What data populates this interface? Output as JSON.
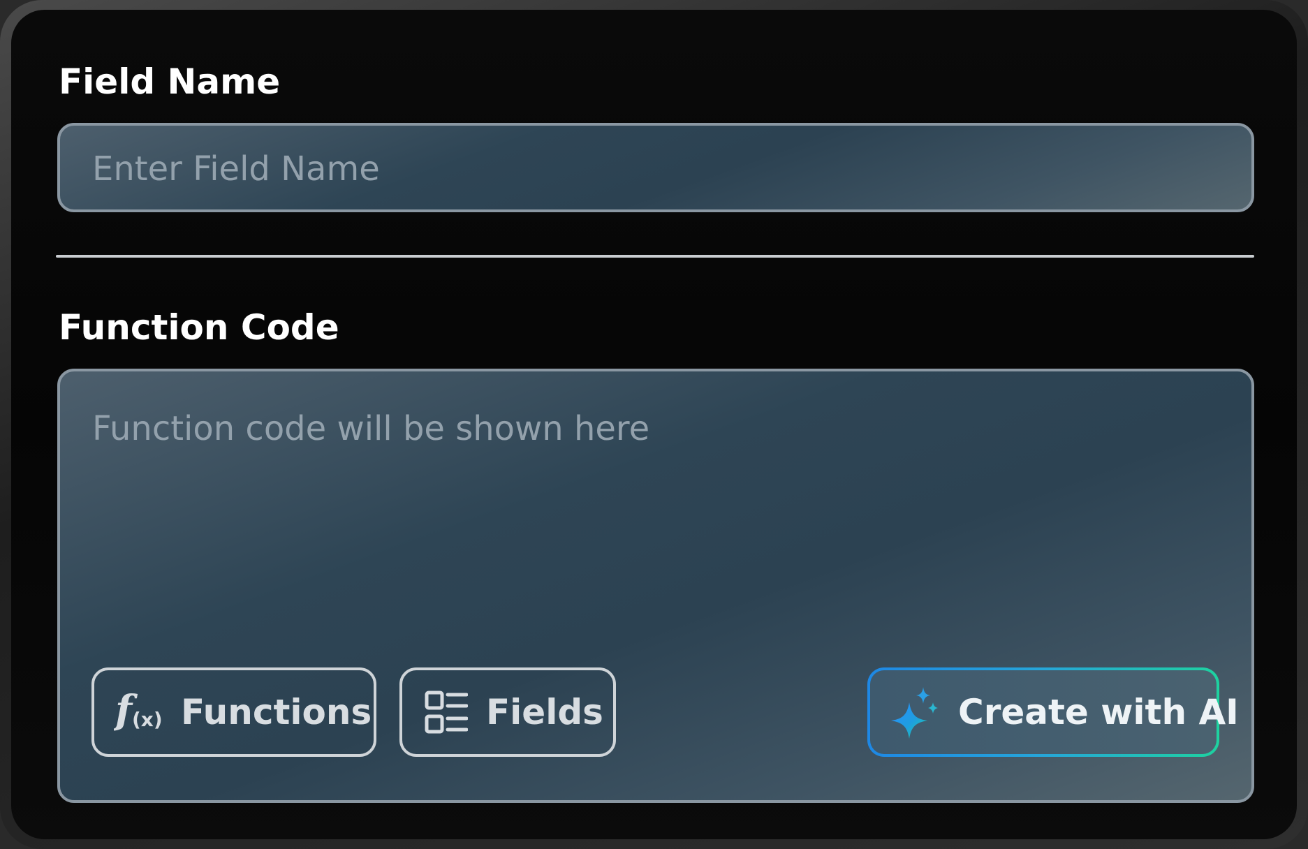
{
  "form": {
    "field_name_label": "Field Name",
    "field_name_placeholder": "Enter Field Name",
    "function_code_label": "Function Code",
    "function_code_placeholder": "Function code will be shown here"
  },
  "actions": {
    "functions_label": "Functions",
    "fields_label": "Fields",
    "ai_label": "Create with AI"
  },
  "icons": {
    "functions": "function-fx-icon",
    "fields": "list-grid-icon",
    "ai": "sparkle-icon"
  },
  "colors": {
    "ai_gradient_start": "#1e88e5",
    "ai_gradient_end": "#1ed2a0"
  }
}
